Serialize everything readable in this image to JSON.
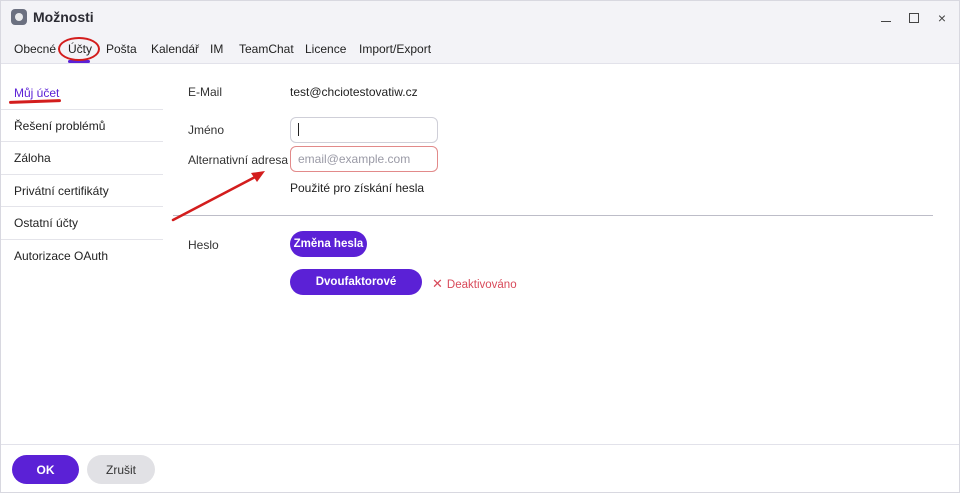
{
  "window": {
    "title": "Možnosti",
    "controls": {
      "minimize": "minimize",
      "maximize": "maximize",
      "close": "×"
    }
  },
  "tabs": [
    {
      "label": "Obecné"
    },
    {
      "label": "Účty",
      "active": true
    },
    {
      "label": "Pošta"
    },
    {
      "label": "Kalendář"
    },
    {
      "label": "IM"
    },
    {
      "label": "TeamChat"
    },
    {
      "label": "Licence"
    },
    {
      "label": "Import/Export"
    }
  ],
  "sidebar": {
    "items": [
      {
        "label": "Můj účet",
        "active": true
      },
      {
        "label": "Řešení problémů"
      },
      {
        "label": "Záloha"
      },
      {
        "label": "Privátní certifikáty"
      },
      {
        "label": "Ostatní účty"
      },
      {
        "label": "Autorizace OAuth"
      }
    ]
  },
  "form": {
    "email_label": "E-Mail",
    "email_value": "test@chciotestovatiw.cz",
    "name_label": "Jméno",
    "name_value": "",
    "alt_label": "Alternativní adresa",
    "alt_placeholder": "email@example.com",
    "alt_hint": "Použité pro získání hesla",
    "password_label": "Heslo",
    "change_password": "Změna hesla",
    "two_factor": "Dvoufaktorové ověřování",
    "two_factor_status": "Deaktivováno"
  },
  "footer": {
    "ok": "OK",
    "cancel": "Zrušit"
  },
  "colors": {
    "accent": "#5b21d6",
    "annotation": "#d31d1d",
    "status_off": "#d84a5a"
  },
  "icons": {
    "app": "app-logo-icon",
    "status_off": "x-icon"
  }
}
